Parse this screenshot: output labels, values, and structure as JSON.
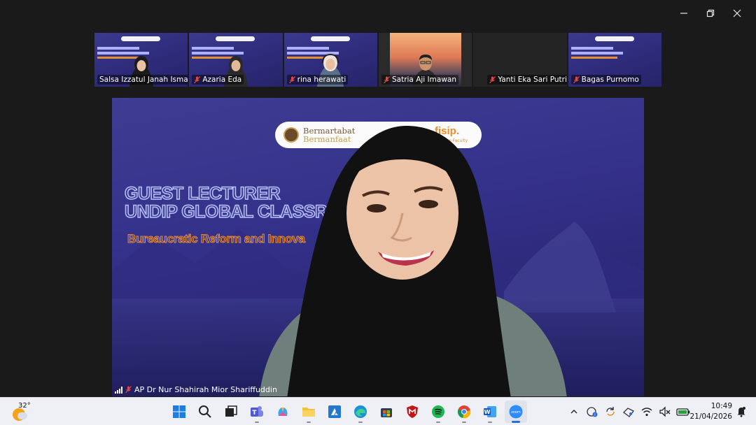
{
  "window": {
    "controls": [
      "minimize",
      "restore",
      "close"
    ]
  },
  "gallery": {
    "participants": [
      {
        "name": "Salsa Izzatul Janah Ismail",
        "muted": false,
        "active": true,
        "view": "slide-with-person"
      },
      {
        "name": "Azaria Eda",
        "muted": true,
        "active": false,
        "view": "slide-with-person"
      },
      {
        "name": "rina herawati",
        "muted": true,
        "active": false,
        "view": "slide-with-person"
      },
      {
        "name": "Satria Aji Imawan",
        "muted": true,
        "active": false,
        "view": "camera"
      },
      {
        "name": "Yanti Eka Sari Putri",
        "muted": true,
        "active": false,
        "view": "empty"
      },
      {
        "name": "Bagas Purnomo",
        "muted": true,
        "active": false,
        "view": "slide"
      }
    ]
  },
  "stage": {
    "logo_line1": "Bermartabat",
    "logo_line2": "Bermanfaat",
    "logo_brand": "fisip.",
    "logo_brand_sub": "World Class Faculty",
    "title_line1": "GUEST LECTURER",
    "title_line2": "UNDIP GLOBAL CLASSRO",
    "subtitle": "Bureaucratic Reform and Innova",
    "speaker_name": "AP Dr Nur Shahirah Mior Shariffuddin",
    "speaker_muted": true
  },
  "taskbar": {
    "weather_temp": "32°",
    "apps": [
      "windows-start",
      "search",
      "task-view",
      "teams",
      "copilot",
      "file-explorer",
      "azure-data-studio",
      "edge",
      "microsoft-store",
      "mcafee",
      "spotify",
      "chrome",
      "word",
      "zoom"
    ],
    "focused_app": "zoom",
    "tray": [
      "show-hidden-icons",
      "onedrive-sync",
      "refresh-sync",
      "vpn",
      "wifi",
      "volume-muted",
      "battery"
    ],
    "time": "10:49",
    "date": "21/04/2026"
  },
  "colors": {
    "active_border": "#2dd38e",
    "slide_bg": "#34318a",
    "accent_orange": "#f08a24",
    "title_stroke": "#b8c2ff",
    "taskbar_bg": "#eef0f5"
  }
}
